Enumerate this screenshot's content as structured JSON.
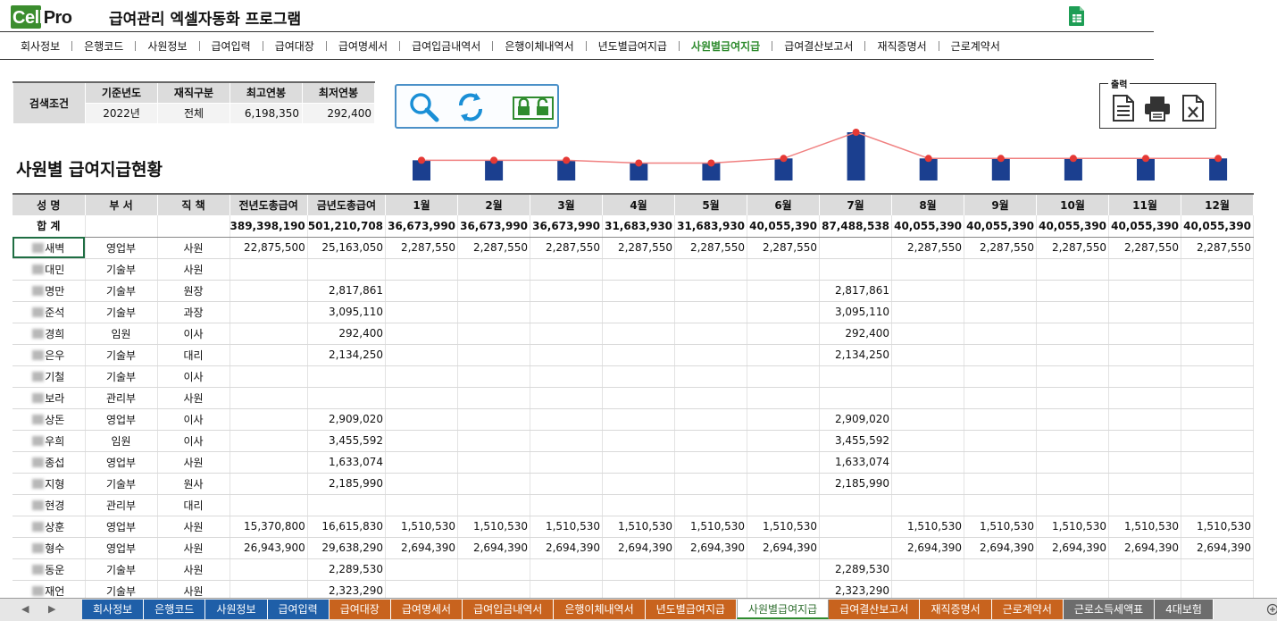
{
  "header": {
    "logo_cell": "Cell",
    "logo_pro": "Pro",
    "title": "급여관리 엑셀자동화 프로그램"
  },
  "menu": [
    {
      "label": "회사정보"
    },
    {
      "label": "은행코드"
    },
    {
      "label": "사원정보"
    },
    {
      "label": "급여입력"
    },
    {
      "label": "급여대장"
    },
    {
      "label": "급여명세서"
    },
    {
      "label": "급여입금내역서"
    },
    {
      "label": "은행이체내역서"
    },
    {
      "label": "년도별급여지급"
    },
    {
      "label": "사원별급여지급",
      "active": true
    },
    {
      "label": "급여결산보고서"
    },
    {
      "label": "재직증명서"
    },
    {
      "label": "근로계약서"
    }
  ],
  "search": {
    "label": "검색조건",
    "headers": [
      "기준년도",
      "재직구분",
      "최고연봉",
      "최저연봉"
    ],
    "values": [
      "2022년",
      "전체",
      "6,198,350",
      "292,400"
    ]
  },
  "toolbar": {
    "search_icon": "search-icon",
    "refresh_icon": "refresh-icon",
    "lock_icon": "lock-unlock-icon"
  },
  "print": {
    "label": "출력",
    "buttons": [
      "document-icon",
      "printer-icon",
      "excel-icon"
    ]
  },
  "section_title": "사원별 급여지급현황",
  "chart_data": {
    "type": "bar",
    "categories": [
      "1월",
      "2월",
      "3월",
      "4월",
      "5월",
      "6월",
      "7월",
      "8월",
      "9월",
      "10월",
      "11월",
      "12월"
    ],
    "values": [
      36673990,
      36673990,
      36673990,
      31683930,
      31683930,
      40055390,
      87488538,
      40055390,
      40055390,
      40055390,
      40055390,
      40055390
    ],
    "overlay": "line",
    "colors": {
      "bar": "#1b3f8f",
      "line": "#f08080",
      "marker": "#e53935"
    }
  },
  "grid": {
    "headers": [
      "성 명",
      "부 서",
      "직 책",
      "전년도총급여",
      "금년도총급여",
      "1월",
      "2월",
      "3월",
      "4월",
      "5월",
      "6월",
      "7월",
      "8월",
      "9월",
      "10월",
      "11월",
      "12월"
    ],
    "total": {
      "label": "합 계",
      "values": [
        "389,398,190",
        "501,210,708",
        "36,673,990",
        "36,673,990",
        "36,673,990",
        "31,683,930",
        "31,683,930",
        "40,055,390",
        "87,488,538",
        "40,055,390",
        "40,055,390",
        "40,055,390",
        "40,055,390",
        "40,055,390"
      ]
    },
    "rows": [
      {
        "name": "새벽",
        "dept": "영업부",
        "title": "사원",
        "prev": "22,875,500",
        "cur": "25,163,050",
        "m": [
          "2,287,550",
          "2,287,550",
          "2,287,550",
          "2,287,550",
          "2,287,550",
          "2,287,550",
          "",
          "2,287,550",
          "2,287,550",
          "2,287,550",
          "2,287,550",
          "2,287,550"
        ]
      },
      {
        "name": "대민",
        "dept": "기술부",
        "title": "사원",
        "prev": "",
        "cur": "",
        "m": [
          "",
          "",
          "",
          "",
          "",
          "",
          "",
          "",
          "",
          "",
          "",
          ""
        ]
      },
      {
        "name": "명만",
        "dept": "기술부",
        "title": "원장",
        "prev": "",
        "cur": "2,817,861",
        "m": [
          "",
          "",
          "",
          "",
          "",
          "",
          "2,817,861",
          "",
          "",
          "",
          "",
          ""
        ]
      },
      {
        "name": "준석",
        "dept": "기술부",
        "title": "과장",
        "prev": "",
        "cur": "3,095,110",
        "m": [
          "",
          "",
          "",
          "",
          "",
          "",
          "3,095,110",
          "",
          "",
          "",
          "",
          ""
        ]
      },
      {
        "name": "경희",
        "dept": "임원",
        "title": "이사",
        "prev": "",
        "cur": "292,400",
        "m": [
          "",
          "",
          "",
          "",
          "",
          "",
          "292,400",
          "",
          "",
          "",
          "",
          ""
        ]
      },
      {
        "name": "은우",
        "dept": "기술부",
        "title": "대리",
        "prev": "",
        "cur": "2,134,250",
        "m": [
          "",
          "",
          "",
          "",
          "",
          "",
          "2,134,250",
          "",
          "",
          "",
          "",
          ""
        ]
      },
      {
        "name": "기철",
        "dept": "기술부",
        "title": "이사",
        "prev": "",
        "cur": "",
        "m": [
          "",
          "",
          "",
          "",
          "",
          "",
          "",
          "",
          "",
          "",
          "",
          ""
        ]
      },
      {
        "name": "보라",
        "dept": "관리부",
        "title": "사원",
        "prev": "",
        "cur": "",
        "m": [
          "",
          "",
          "",
          "",
          "",
          "",
          "",
          "",
          "",
          "",
          "",
          ""
        ]
      },
      {
        "name": "상돈",
        "dept": "영업부",
        "title": "이사",
        "prev": "",
        "cur": "2,909,020",
        "m": [
          "",
          "",
          "",
          "",
          "",
          "",
          "2,909,020",
          "",
          "",
          "",
          "",
          ""
        ]
      },
      {
        "name": "우희",
        "dept": "임원",
        "title": "이사",
        "prev": "",
        "cur": "3,455,592",
        "m": [
          "",
          "",
          "",
          "",
          "",
          "",
          "3,455,592",
          "",
          "",
          "",
          "",
          ""
        ]
      },
      {
        "name": "종섭",
        "dept": "영업부",
        "title": "사원",
        "prev": "",
        "cur": "1,633,074",
        "m": [
          "",
          "",
          "",
          "",
          "",
          "",
          "1,633,074",
          "",
          "",
          "",
          "",
          ""
        ]
      },
      {
        "name": "지형",
        "dept": "기술부",
        "title": "원사",
        "prev": "",
        "cur": "2,185,990",
        "m": [
          "",
          "",
          "",
          "",
          "",
          "",
          "2,185,990",
          "",
          "",
          "",
          "",
          ""
        ]
      },
      {
        "name": "현경",
        "dept": "관리부",
        "title": "대리",
        "prev": "",
        "cur": "",
        "m": [
          "",
          "",
          "",
          "",
          "",
          "",
          "",
          "",
          "",
          "",
          "",
          ""
        ]
      },
      {
        "name": "상훈",
        "dept": "영업부",
        "title": "사원",
        "prev": "15,370,800",
        "cur": "16,615,830",
        "m": [
          "1,510,530",
          "1,510,530",
          "1,510,530",
          "1,510,530",
          "1,510,530",
          "1,510,530",
          "",
          "1,510,530",
          "1,510,530",
          "1,510,530",
          "1,510,530",
          "1,510,530"
        ]
      },
      {
        "name": "형수",
        "dept": "영업부",
        "title": "사원",
        "prev": "26,943,900",
        "cur": "29,638,290",
        "m": [
          "2,694,390",
          "2,694,390",
          "2,694,390",
          "2,694,390",
          "2,694,390",
          "2,694,390",
          "",
          "2,694,390",
          "2,694,390",
          "2,694,390",
          "2,694,390",
          "2,694,390"
        ]
      },
      {
        "name": "동운",
        "dept": "기술부",
        "title": "사원",
        "prev": "",
        "cur": "2,289,530",
        "m": [
          "",
          "",
          "",
          "",
          "",
          "",
          "2,289,530",
          "",
          "",
          "",
          "",
          ""
        ]
      },
      {
        "name": "재언",
        "dept": "기술부",
        "title": "사원",
        "prev": "",
        "cur": "2,323,290",
        "m": [
          "",
          "",
          "",
          "",
          "",
          "",
          "2,323,290",
          "",
          "",
          "",
          "",
          ""
        ]
      }
    ]
  },
  "tabs": [
    {
      "label": "회사정보",
      "color": "blue"
    },
    {
      "label": "은행코드",
      "color": "blue"
    },
    {
      "label": "사원정보",
      "color": "blue"
    },
    {
      "label": "급여입력",
      "color": "blue"
    },
    {
      "label": "급여대장",
      "color": "orange"
    },
    {
      "label": "급여명세서",
      "color": "orange"
    },
    {
      "label": "급여입금내역서",
      "color": "orange"
    },
    {
      "label": "은행이체내역서",
      "color": "orange"
    },
    {
      "label": "년도별급여지급",
      "color": "orange"
    },
    {
      "label": "사원별급여지급",
      "color": "active"
    },
    {
      "label": "급여결산보고서",
      "color": "orange"
    },
    {
      "label": "재직증명서",
      "color": "orange"
    },
    {
      "label": "근로계약서",
      "color": "orange"
    },
    {
      "label": "근로소득세액표",
      "color": "gray"
    },
    {
      "label": "4대보험",
      "color": "gray"
    }
  ]
}
